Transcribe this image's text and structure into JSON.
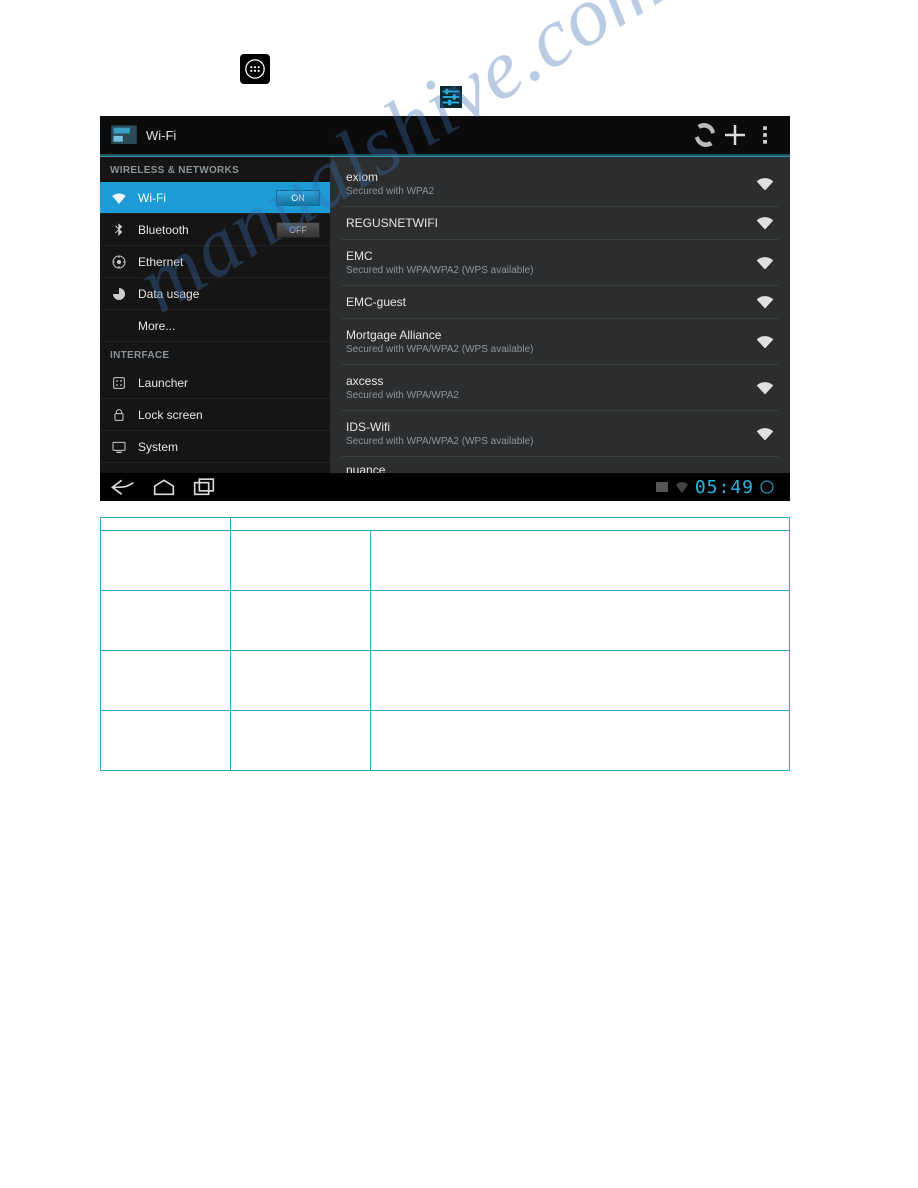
{
  "watermark": "manualshive.com",
  "settings": {
    "title": "Wi-Fi",
    "sections": {
      "wireless": "WIRELESS & NETWORKS",
      "interface": "INTERFACE"
    },
    "sidebar": {
      "wifi": {
        "label": "Wi-Fi",
        "toggle": "ON"
      },
      "bluetooth": {
        "label": "Bluetooth",
        "toggle": "OFF"
      },
      "ethernet": {
        "label": "Ethernet"
      },
      "datausage": {
        "label": "Data usage"
      },
      "more": {
        "label": "More..."
      },
      "launcher": {
        "label": "Launcher"
      },
      "lockscreen": {
        "label": "Lock screen"
      },
      "system": {
        "label": "System"
      }
    },
    "networks": [
      {
        "name": "exiom",
        "sub": "Secured with WPA2"
      },
      {
        "name": "REGUSNETWIFI",
        "sub": ""
      },
      {
        "name": "EMC",
        "sub": "Secured with WPA/WPA2 (WPS available)"
      },
      {
        "name": "EMC-guest",
        "sub": ""
      },
      {
        "name": "Mortgage Alliance",
        "sub": "Secured with WPA/WPA2 (WPS available)"
      },
      {
        "name": "axcess",
        "sub": "Secured with WPA/WPA2"
      },
      {
        "name": "IDS-Wifi",
        "sub": "Secured with WPA/WPA2 (WPS available)"
      },
      {
        "name": "nuance",
        "sub": ""
      }
    ],
    "clock": "05:49"
  }
}
